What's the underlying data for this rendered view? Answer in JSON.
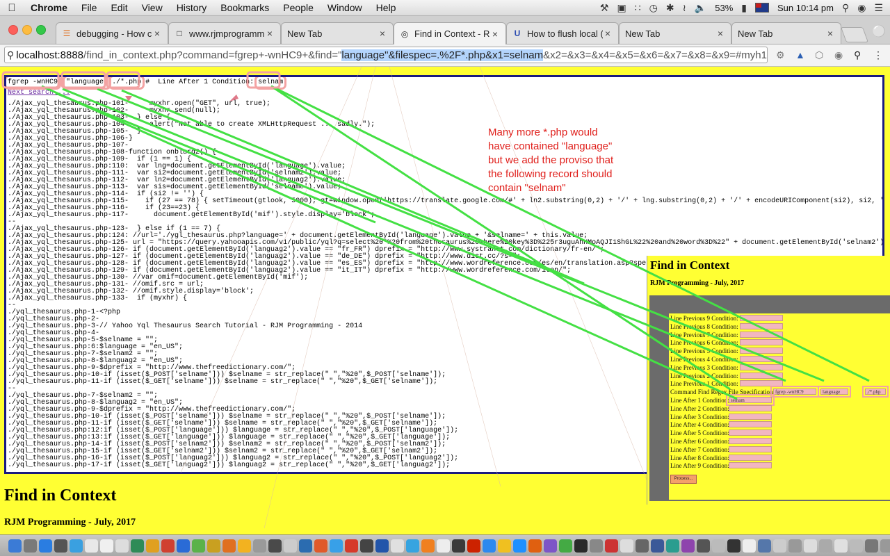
{
  "menubar": {
    "app": "Chrome",
    "items": [
      "File",
      "Edit",
      "View",
      "History",
      "Bookmarks",
      "People",
      "Window",
      "Help"
    ],
    "battery": "53%",
    "clock": "Sun 10:14 pm"
  },
  "tabs": [
    {
      "title": "debugging - How c"
    },
    {
      "title": "www.rjmprogramm"
    },
    {
      "title": "New Tab"
    },
    {
      "title": "Find in Context - R"
    },
    {
      "title": "How to flush local ("
    },
    {
      "title": "New Tab"
    },
    {
      "title": "New Tab"
    }
  ],
  "address": {
    "host": "localhost:8888",
    "path_pre": "/find_in_context.php?command=fgrep+-wnHC9+&find=\"",
    "path_sel": "language\"&filespec=.%2F*.php&x1=selnam",
    "path_post": "&x2=&x3=&x4=&x5=&x6=&x7=&x8=&x9=#myh1"
  },
  "results": {
    "cmd_fgrep": "fgrep -wnHC9",
    "cmd_find": "\"language\"",
    "cmd_filespec": "./*.php",
    "cmd_mid": " #  Line After 1 Condition: ",
    "cmd_cond": "selnam",
    "next_search": "Next search ...",
    "lines": [
      "./Ajax_yql_thesaurus.php-101-     myxhr.open(\"GET\", url, true);",
      "./Ajax_yql_thesaurus.php-102-     myxhr.send(null);",
      "./Ajax_yql_thesaurus.php-103-  } else {",
      "./Ajax_yql_thesaurus.php-104-     alert(\"Not able to create XMLHttpRequest ... sadly.\");",
      "./Ajax_yql_thesaurus.php-105-  }",
      "./Ajax_yql_thesaurus.php-106-}",
      "./Ajax_yql_thesaurus.php-107-",
      "./Ajax_yql_thesaurus.php-108-function onblurd2() {",
      "./Ajax_yql_thesaurus.php-109-  if (1 == 1) {",
      "./Ajax_yql_thesaurus.php:110:  var lng=document.getElementById('language').value;",
      "./Ajax_yql_thesaurus.php-111-  var si2=document.getElementById('selnam2').value;",
      "./Ajax_yql_thesaurus.php-112-  var ln2=document.getElementById('languag2').value;",
      "./Ajax_yql_thesaurus.php-113-  var sis=document.getElementById('selname').value;",
      "./Ajax_yql_thesaurus.php-114-  if (si2 != '') {",
      "./Ajax_yql_thesaurus.php-115-    if (27 == 78) { setTimeout(gtlook, 5000); gt=window.open('https://translate.google.com/#' + ln2.substring(0,2) + '/' + lng.substring(0,2) + '/' + encodeURIComponent(si2), si2, 'left=10",
      "./Ajax_yql_thesaurus.php-116-    if (23==23) {",
      "./Ajax_yql_thesaurus.php-117-      document.getElementById('mif').style.display='block';",
      "--",
      "./Ajax_yql_thesaurus.php-123-  } else if (1 == 7) {",
      "./Ajax_yql_thesaurus.php:124: //url='./ygl_thesaurus.php?language=' + document.getElementById('language').value + '&selname=' + this.value;",
      "./Ajax_yql_thesaurus.php-125- url = \"https://query.yahooapis.com/v1/public/yql?q=select%20*%20from%20thesaurus%20where%20key%3D%225r3uguAhHMoAQJI1ShGL%22%20and%20word%3D%22\" + document.getElementById('selnam2').value.",
      "./Ajax_yql_thesaurus.php-126- if (document.getElementById('languag2').value == \"fr_FR\") dprefix = \"http://www.systranet.com/dictionary/fr-en/\";",
      "./Ajax_yql_thesaurus.php-127- if (document.getElementById('languag2').value == \"de_DE\") dprefix = \"http://www.dict.cc/?s=\";",
      "./Ajax_yql_thesaurus.php-128- if (document.getElementById('languag2').value == \"es_ES\") dprefix = \"http://www.wordreference.com/es/en/translation.asp?spen=\";",
      "./Ajax_yql_thesaurus.php-129- if (document.getElementById('languag2').value == \"it_IT\") dprefix = \"http://www.wordreference.com/iten/\";",
      "./Ajax_yql_thesaurus.php-130- //var omif=document.getElementById('mif');",
      "./Ajax_yql_thesaurus.php-131- //omif.src = url;",
      "./Ajax_yql_thesaurus.php-132- //omif.style.display='block';",
      "./Ajax_yql_thesaurus.php-133-  if (myxhr) {",
      "--",
      "./yql_thesaurus.php-1-<?php",
      "./yql_thesaurus.php-2-",
      "./yql_thesaurus.php-3-// Yahoo Yql Thesaurus Search Tutorial - RJM Programming - 2014",
      "./yql_thesaurus.php-4-",
      "./yql_thesaurus.php-5-$selname = \"\";",
      "./yql_thesaurus.php:6:$language = \"en_US\";",
      "./yql_thesaurus.php-7-$selnam2 = \"\";",
      "./yql_thesaurus.php-8-$languag2 = \"en_US\";",
      "./yql_thesaurus.php-9-$dprefix = \"http://www.thefreedictionary.com/\";",
      "./yql_thesaurus.php-10-if (isset($_POST['selname'])) $selname = str_replace(\" \",\"%20\",$_POST['selname']);",
      "./yql_thesaurus.php-11-if (isset($_GET['selname'])) $selname = str_replace(\" \",\"%20\",$_GET['selname']);",
      "--",
      "./yql_thesaurus.php-7-$selnam2 = \"\";",
      "./yql_thesaurus.php-8-$languag2 = \"en_US\";",
      "./yql_thesaurus.php-9-$dprefix = \"http://www.thefreedictionary.com/\";",
      "./yql_thesaurus.php-10-if (isset($_POST['selname'])) $selname = str_replace(\" \",\"%20\",$_POST['selname']);",
      "./yql_thesaurus.php-11-if (isset($_GET['selname'])) $selname = str_replace(\" \",\"%20\",$_GET['selname']);",
      "./yql_thesaurus.php:12:if (isset($_POST['language'])) $language = str_replace(\" \",\"%20\",$_POST['language']);",
      "./yql_thesaurus.php:13:if (isset($_GET['language'])) $language = str_replace(\" \",\"%20\",$_GET['language']);",
      "./yql_thesaurus.php-14-if (isset($_POST['selnam2'])) $selnam2 = str_replace(\" \",\"%20\",$_POST['selnam2']);",
      "./yql_thesaurus.php-15-if (isset($_GET['selnam2'])) $selnam2 = str_replace(\" \",\"%20\",$_GET['selnam2']);",
      "./yql_thesaurus.php-16-if (isset($_POST['languag2'])) $languag2 = str_replace(\" \",\"%20\",$_POST['languag2']);",
      "./yql_thesaurus.php-17-if (isset($_GET['languag2'])) $languag2 = str_replace(\" \",\"%20\",$_GET['languag2']);"
    ]
  },
  "annotation": "Many more *.php would\nhave contained \"language\"\nbut we add the proviso that\nthe following record should\ncontain \"selnam\"",
  "page": {
    "title": "Find in Context",
    "subtitle": "RJM Programming - July, 2017"
  },
  "inset": {
    "title": "Find in Context",
    "subtitle": "RJM Programming - July, 2017",
    "prev_labels": [
      "Line Previous 9 Condition:",
      "Line Previous 8 Condition:",
      "Line Previous 7 Condition:",
      "Line Previous 6 Condition:",
      "Line Previous 5 Condition:",
      "Line Previous 4 Condition:",
      "Line Previous 3 Condition:",
      "Line Previous 2 Condition:",
      "Line Previous 1 Condition:"
    ],
    "command_label": "Command Find Regex File Specification:",
    "command_value": "fgrep -wnHC9",
    "find_value": "language",
    "filespec_value": "./*.php",
    "after_labels": [
      "Line After 1 Condition:",
      "Line After 2 Condition:",
      "Line After 3 Condition:",
      "Line After 4 Condition:",
      "Line After 5 Condition:",
      "Line After 6 Condition:",
      "Line After 7 Condition:",
      "Line After 8 Condition:",
      "Line After 9 Condition:"
    ],
    "after1_value": "selnam",
    "process_label": "Process..."
  },
  "colors": {
    "page_bg": "#ffff33",
    "annotation": "#e0201c",
    "arrow_green": "#44e044",
    "highlight_pink": "#f3a3a3",
    "results_border": "#1a1a80"
  },
  "dock": {
    "colors": [
      "#3b7bd6",
      "#7a7a7a",
      "#2a7de1",
      "#555555",
      "#3aa0e0",
      "#e8e8e8",
      "#f0f0f0",
      "#dddddd",
      "#2e8b57",
      "#e0a020",
      "#d04030",
      "#2a6bd6",
      "#5bb24a",
      "#c9a020",
      "#e07020",
      "#f2b220",
      "#9a9a9a",
      "#4a4a4a",
      "#cccccc",
      "#2b6cb0",
      "#e05a2a",
      "#38a0e8",
      "#d63a2a",
      "#444444",
      "#2255aa",
      "#e0e0e0",
      "#36a4e0",
      "#f08020",
      "#ededed",
      "#3a3a3a",
      "#cc2200",
      "#2d89ef",
      "#f0c020",
      "#1e90ff",
      "#e06010",
      "#7d55c7",
      "#44aa44",
      "#2a2a2a",
      "#888888",
      "#cc3333",
      "#dddddd",
      "#666666",
      "#3b5998",
      "#2a9d8f",
      "#8e44ad",
      "#555555",
      "#bbbbbb",
      "#333333",
      "#eeeeee",
      "#5577aa",
      "#cccccc",
      "#999999",
      "#dddddd",
      "#aaaaaa",
      "#e0e0e0",
      "#bbbbbb",
      "#777777",
      "#999999",
      "#cccccc"
    ]
  }
}
